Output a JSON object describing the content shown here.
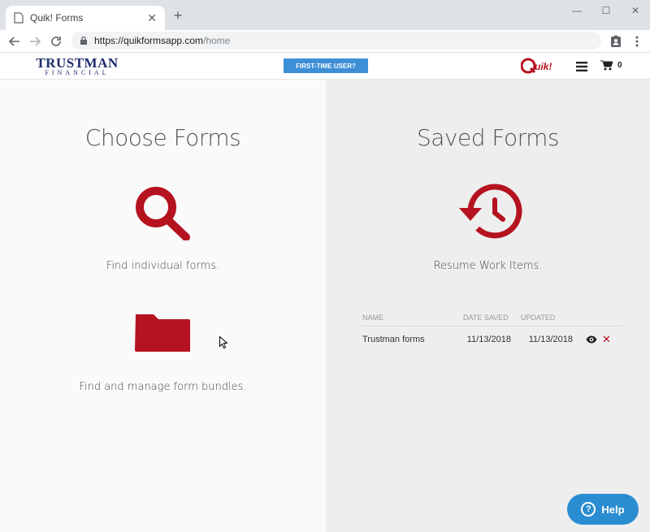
{
  "browser": {
    "tab_title": "Quik! Forms",
    "tab_close": "✕",
    "new_tab": "+",
    "url_host": "https://quikformsapp.com",
    "url_path": "/home",
    "window_controls": [
      "—",
      "☐",
      "✕"
    ]
  },
  "header": {
    "brand_line1": "TRUSTMAN",
    "brand_line2": "FINANCIAL",
    "first_time_label": "FIRST-TIME USER?",
    "quik_logo_text": "Quik!",
    "cart_count": "0"
  },
  "choose": {
    "title": "Choose Forms",
    "find_individual": "Find individual forms.",
    "find_bundles": "Find and manage form bundles."
  },
  "saved": {
    "title": "Saved Forms",
    "resume": "Resume Work Items.",
    "columns": {
      "name": "NAME",
      "date_saved": "DATE SAVED",
      "updated": "UPDATED"
    },
    "rows": [
      {
        "name": "Trustman forms",
        "date_saved": "11/13/2018",
        "updated": "11/13/2018"
      }
    ],
    "delete_glyph": "✕"
  },
  "help": {
    "label": "Help",
    "glyph": "?"
  },
  "colors": {
    "accent_red": "#b5131f",
    "brand_navy": "#1f2d6e",
    "button_blue": "#3d8fd6",
    "help_blue": "#2b8dd1"
  }
}
